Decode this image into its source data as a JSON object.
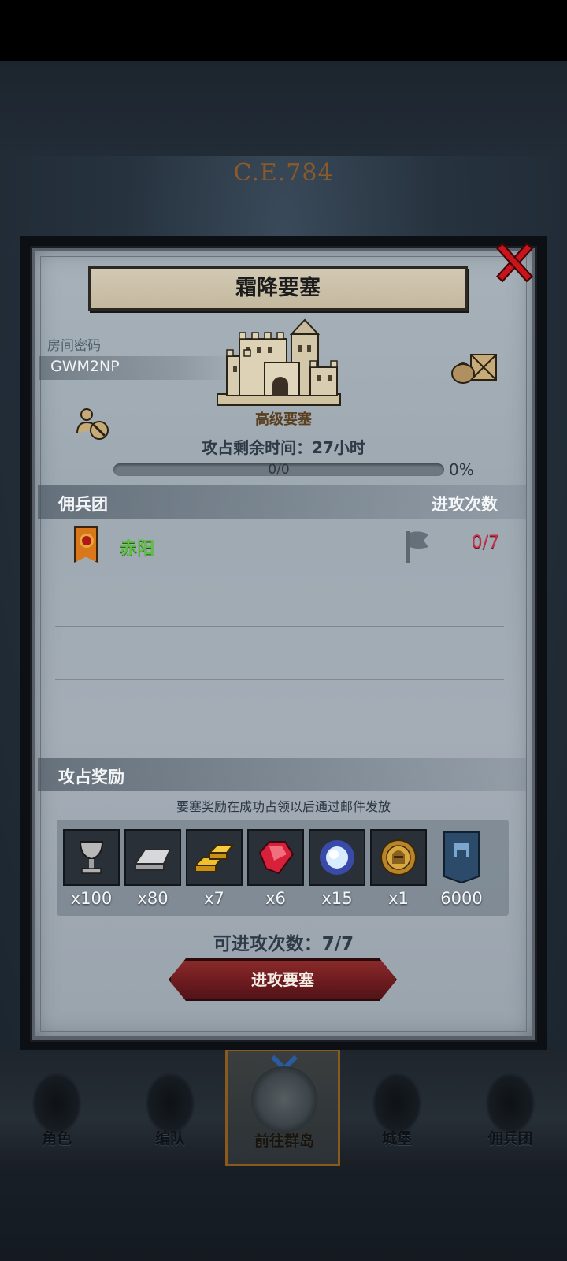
{
  "background": {
    "era": "C.E.784"
  },
  "dialog": {
    "title": "霜降要塞",
    "room_label": "房间密码",
    "room_code": "GWM2NP",
    "fortress_type": "高级要塞",
    "time_left": "攻占剩余时间：27小时",
    "progress": {
      "count": "0/0",
      "percent": "0%",
      "fraction": 0
    },
    "mercenary_header": "佣兵团",
    "attacks_header": "进攻次数",
    "mercenaries": [
      {
        "name": "赤阳",
        "attacks": "0/7",
        "banner_color": "#d8781a"
      }
    ],
    "rewards_header": "攻占奖励",
    "rewards_note": "要塞奖励在成功占领以后通过邮件发放",
    "rewards": [
      {
        "icon": "goblet-icon",
        "qty": "x100"
      },
      {
        "icon": "silver-ingot-icon",
        "qty": "x80"
      },
      {
        "icon": "gold-bars-icon",
        "qty": "x7"
      },
      {
        "icon": "ruby-icon",
        "qty": "x6"
      },
      {
        "icon": "crystal-orb-icon",
        "qty": "x15"
      },
      {
        "icon": "knight-medal-icon",
        "qty": "x1"
      },
      {
        "icon": "blue-banner-icon",
        "qty": "6000"
      }
    ],
    "attacks_available": "可进攻次数：7/7",
    "attack_button": "进攻要塞"
  },
  "bottom_nav": [
    {
      "label": "角色",
      "icon": "knight-icon"
    },
    {
      "label": "编队",
      "icon": "formation-icon"
    },
    {
      "label": "前往群岛",
      "icon": "islands-compass-icon",
      "active": true
    },
    {
      "label": "城堡",
      "icon": "castle-nav-icon"
    },
    {
      "label": "佣兵团",
      "icon": "ship-icon"
    }
  ],
  "colors": {
    "accent_red": "#c8141a",
    "merc_name_green": "#5cc040",
    "attack_count_red": "#c8304a"
  }
}
